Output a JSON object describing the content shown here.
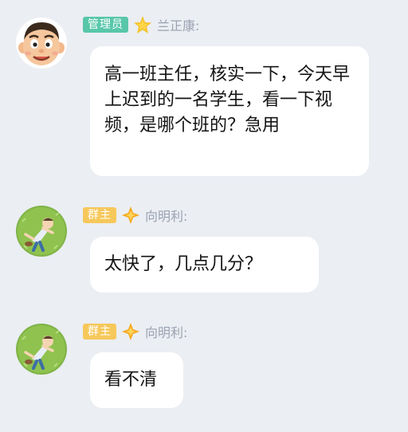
{
  "messages": [
    {
      "role_badge": "管理员",
      "sender": "兰正康:",
      "avatar_icon": "cartoon-boy-avatar-icon",
      "text": "高一班主任，核实一下，今天早上迟到的一名学生，看一下视频，是哪个班的？急用"
    },
    {
      "role_badge": "群主",
      "sender": "向明利:",
      "avatar_icon": "sleeping-figure-on-grass-avatar-icon",
      "text": "太快了，几点几分？"
    },
    {
      "role_badge": "群主",
      "sender": "向明利:",
      "avatar_icon": "sleeping-figure-on-grass-avatar-icon",
      "text": "看不清"
    }
  ],
  "colors": {
    "background": "#ebeef3",
    "bubble": "#ffffff",
    "admin_badge": "#58c7a9",
    "owner_badge": "#f6c85b",
    "sender_name": "#9aa3b2"
  }
}
